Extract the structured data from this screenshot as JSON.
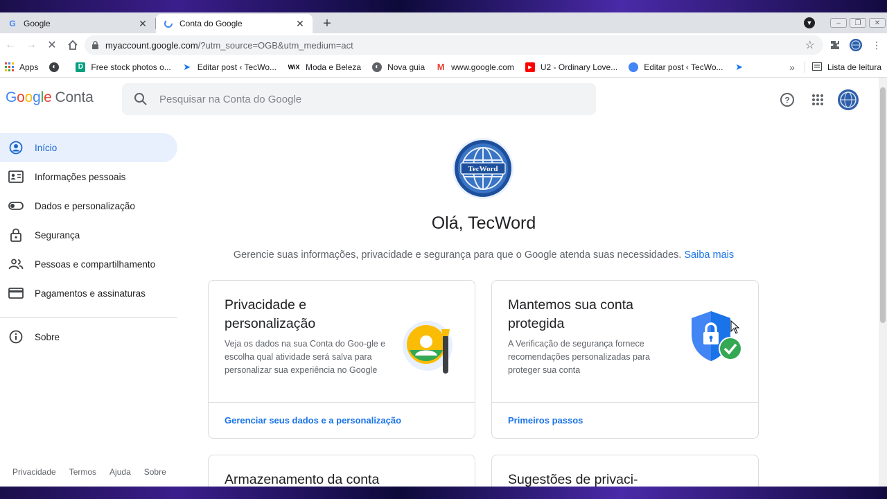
{
  "browser": {
    "tabs": [
      {
        "title": "Google",
        "icon": "google-g-icon"
      },
      {
        "title": "Conta do Google",
        "icon": "loading-icon"
      }
    ],
    "url_host": "myaccount.google.com",
    "url_rest": "/?utm_source=OGB&utm_medium=act",
    "bookmarks": [
      {
        "label": "Apps",
        "icon": "apps-grid-icon"
      },
      {
        "label": "",
        "icon": "globe-icon"
      },
      {
        "label": "Free stock photos o...",
        "icon": "d-icon"
      },
      {
        "label": "Editar post ‹ TecWo...",
        "icon": "play-arrow-icon"
      },
      {
        "label": "Moda e Beleza",
        "icon": "wix-icon"
      },
      {
        "label": "Nova guia",
        "icon": "globe-icon"
      },
      {
        "label": "www.google.com",
        "icon": "gmail-icon"
      },
      {
        "label": "U2 - Ordinary Love...",
        "icon": "youtube-icon"
      },
      {
        "label": "Editar post ‹ TecWo...",
        "icon": "blue-circle-icon"
      },
      {
        "label": "",
        "icon": "play-arrow-icon"
      }
    ],
    "more": "»",
    "reading_list": "Lista de leitura"
  },
  "account": {
    "logo_letters": [
      "G",
      "o",
      "o",
      "g",
      "l",
      "e"
    ],
    "logo_suffix": "Conta",
    "search_placeholder": "Pesquisar na Conta do Google",
    "avatar_text": "TecWord",
    "greeting": "Olá, TecWord",
    "subtitle": "Gerencie suas informações, privacidade e segurança para que o Google atenda suas necessidades.",
    "subtitle_link": "Saiba mais"
  },
  "sidebar": {
    "items": [
      {
        "label": "Início",
        "icon": "account-circle-icon",
        "active": true
      },
      {
        "label": "Informações pessoais",
        "icon": "id-card-icon"
      },
      {
        "label": "Dados e personalização",
        "icon": "toggle-icon"
      },
      {
        "label": "Segurança",
        "icon": "lock-icon"
      },
      {
        "label": "Pessoas e compartilhamento",
        "icon": "people-icon"
      },
      {
        "label": "Pagamentos e assinaturas",
        "icon": "credit-card-icon"
      }
    ],
    "about": {
      "label": "Sobre",
      "icon": "info-icon"
    },
    "footer": [
      "Privacidade",
      "Termos",
      "Ajuda",
      "Sobre"
    ]
  },
  "cards": [
    {
      "title": "Privacidade e personalização",
      "desc": "Veja os dados na sua Conta do Goo-gle e escolha qual atividade será salva para personalizar sua experiência no Google",
      "link": "Gerenciar seus dados e a personalização",
      "icon": "privacy-illustration-icon"
    },
    {
      "title": "Mantemos sua conta protegida",
      "desc": "A Verificação de segurança fornece recomendações personalizadas para proteger sua conta",
      "link": "Primeiros passos",
      "icon": "shield-check-icon"
    },
    {
      "title": "Armazenamento da conta"
    },
    {
      "title": "Sugestões de privaci-"
    }
  ],
  "colors": {
    "accent": "#1a73e8",
    "active_bg": "#e8f0fe",
    "text": "#202124",
    "muted": "#5f6368"
  }
}
